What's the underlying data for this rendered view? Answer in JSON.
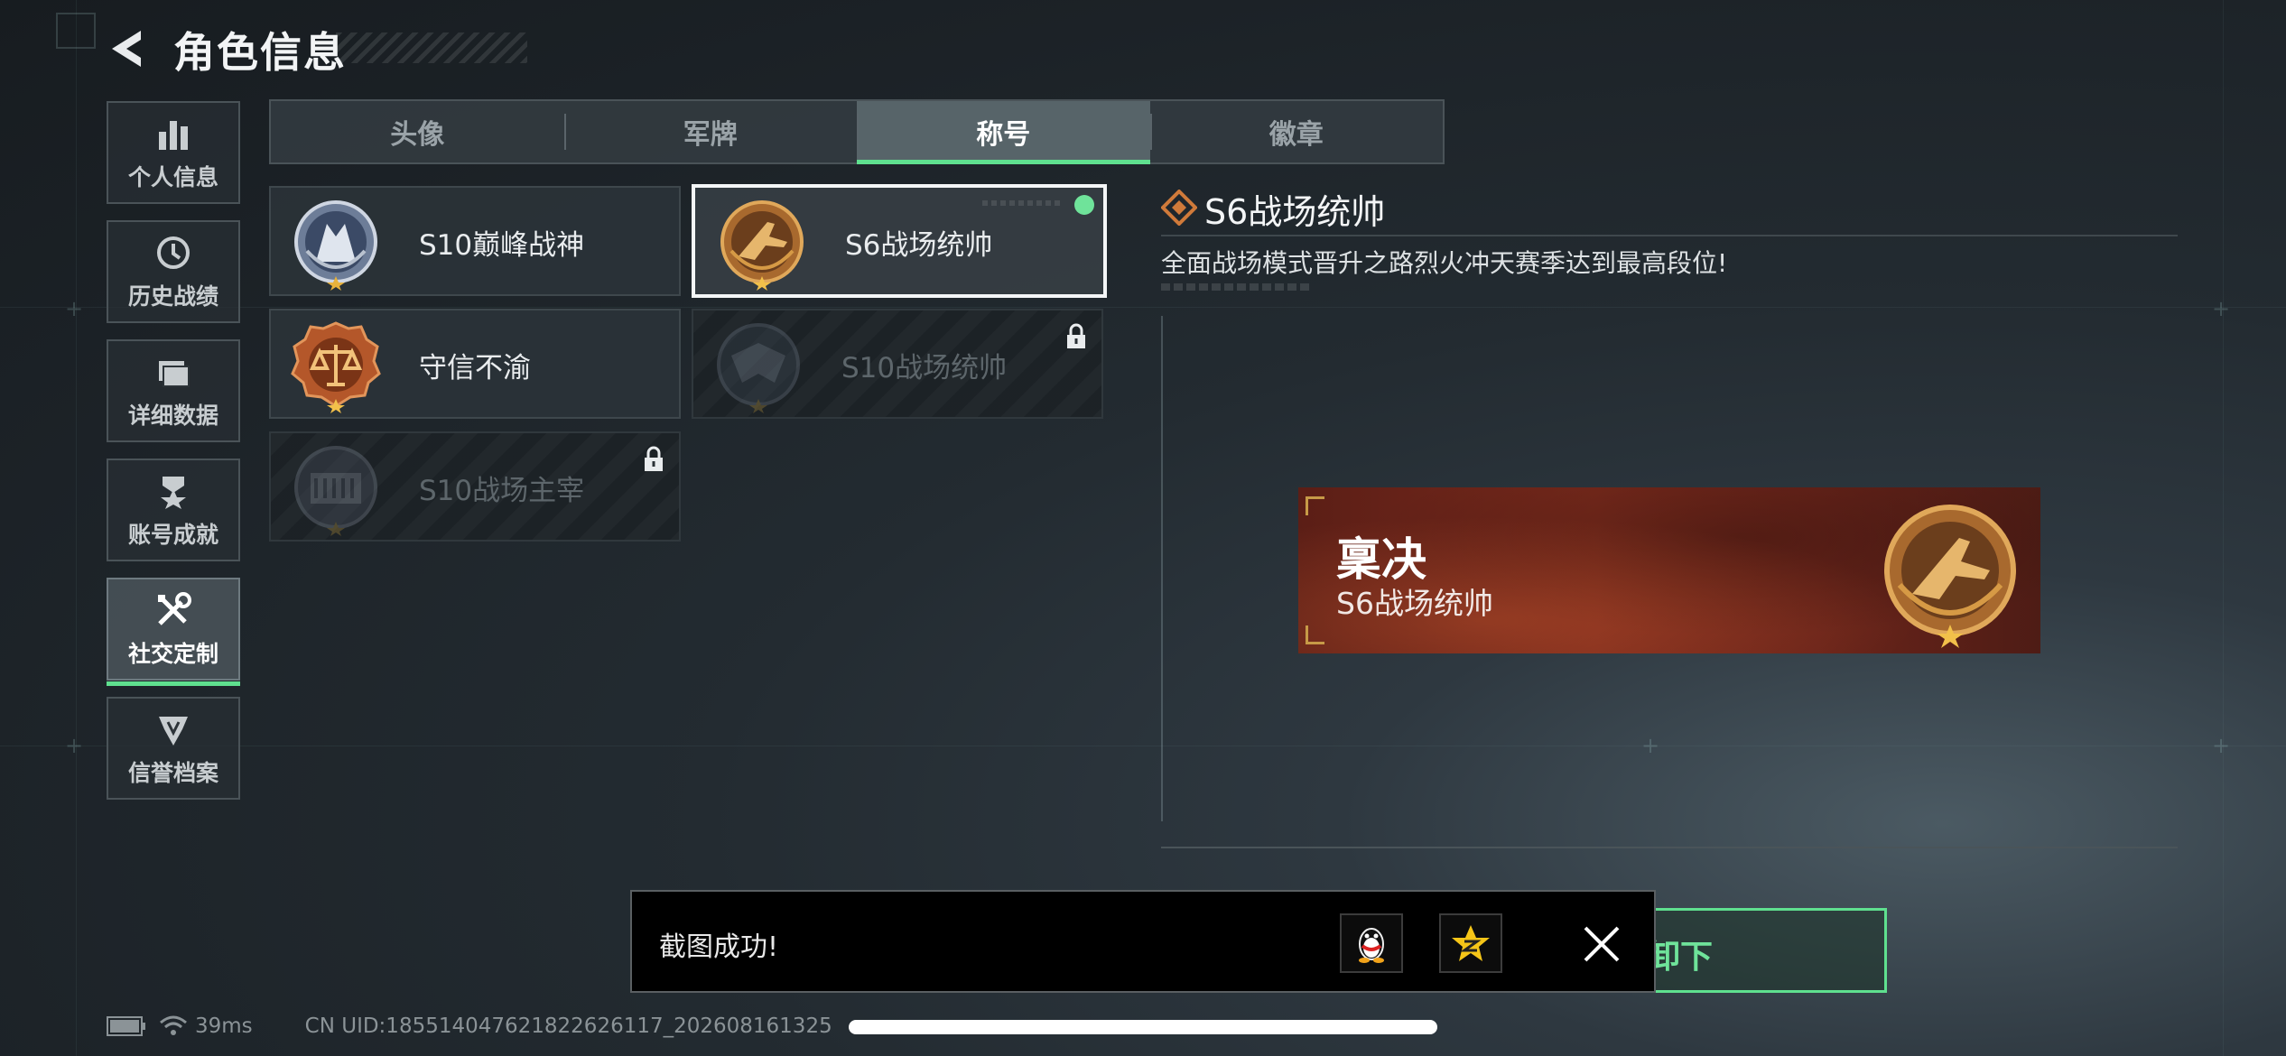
{
  "header": {
    "title": "角色信息"
  },
  "nav": [
    {
      "label": "个人信息",
      "icon": "bar-chart-icon"
    },
    {
      "label": "历史战绩",
      "icon": "clock-icon"
    },
    {
      "label": "详细数据",
      "icon": "folder-icon"
    },
    {
      "label": "账号成就",
      "icon": "achievement-icon"
    },
    {
      "label": "社交定制",
      "icon": "tools-icon",
      "active": true
    },
    {
      "label": "信誉档案",
      "icon": "credit-shield-icon"
    }
  ],
  "tabs": [
    {
      "label": "头像"
    },
    {
      "label": "军牌"
    },
    {
      "label": "称号",
      "active": true
    },
    {
      "label": "徽章"
    }
  ],
  "titles": [
    {
      "name": "S10巅峰战神",
      "locked": false
    },
    {
      "name": "S6战场统帅",
      "locked": false,
      "selected": true,
      "equipped": true
    },
    {
      "name": "守信不渝",
      "locked": false
    },
    {
      "name": "S10战场统帅",
      "locked": true
    },
    {
      "name": "S10战场主宰",
      "locked": true
    }
  ],
  "detail": {
    "title": "S6战场统帅",
    "description": "全面战场模式晋升之路烈火冲天赛季达到最高段位!"
  },
  "preview": {
    "player_name": "稟决",
    "title": "S6战场统帅"
  },
  "confirm": {
    "label_visible": "卸下"
  },
  "toast": {
    "message": "截图成功!",
    "share_qq_icon": "qq-penguin-icon",
    "share_qzone_icon": "qzone-star-icon"
  },
  "status": {
    "ping": "39ms",
    "uid": "CN UID:18551404762182262611​7_202608161325"
  },
  "colors": {
    "accent": "#5fe08f",
    "banner": "#7a2a1c",
    "gold": "#c79a47"
  }
}
